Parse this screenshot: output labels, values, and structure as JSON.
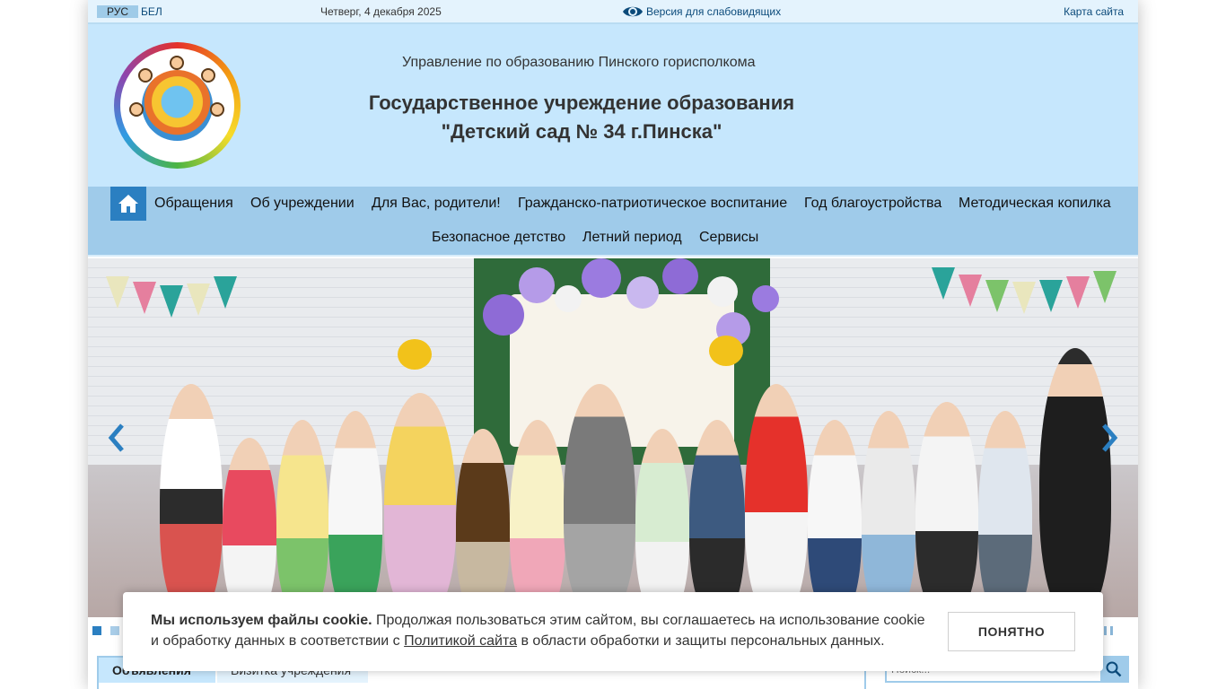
{
  "topbar": {
    "lang_ru": "РУС",
    "lang_by": "БЕЛ",
    "date": "Четверг, 4 декабря 2025",
    "low_vision": "Версия для слабовидящих",
    "sitemap": "Карта сайта"
  },
  "header": {
    "org_top": "Управление по образованию Пинского горисполкома",
    "org_name_line1": "Государственное учреждение образования",
    "org_name_line2": "\"Детский сад № 34 г.Пинска\""
  },
  "nav": {
    "items": [
      "Обращения",
      "Об учреждении",
      "Для Вас, родители!",
      "Гражданско-патриотическое воспитание",
      "Год благоустройства",
      "Методическая копилка",
      "Безопасное детство",
      "Летний период",
      "Сервисы"
    ]
  },
  "tabs": {
    "active": "Объявления",
    "second": "Визитка учреждения"
  },
  "search": {
    "placeholder": "Поиск..."
  },
  "cookie": {
    "title": "Мы используем файлы cookie.",
    "text_before_link": " Продолжая пользоваться этим сайтом, вы соглашаетесь на использование cookie и обработку данных в соответствии с ",
    "link": "Политикой сайта",
    "text_after_link": " в области обработки и защиты персональных данных.",
    "button": "ПОНЯТНО"
  },
  "colors": {
    "header_bg": "#c6e7fd",
    "nav_bg": "#9fcbea",
    "accent": "#2b7fc1",
    "link": "#0b4a7a"
  },
  "icons": {
    "home": "home-icon",
    "eye": "eye-icon",
    "search": "search-icon",
    "prev": "chevron-left-icon",
    "next": "chevron-right-icon",
    "pause": "pause-icon"
  }
}
